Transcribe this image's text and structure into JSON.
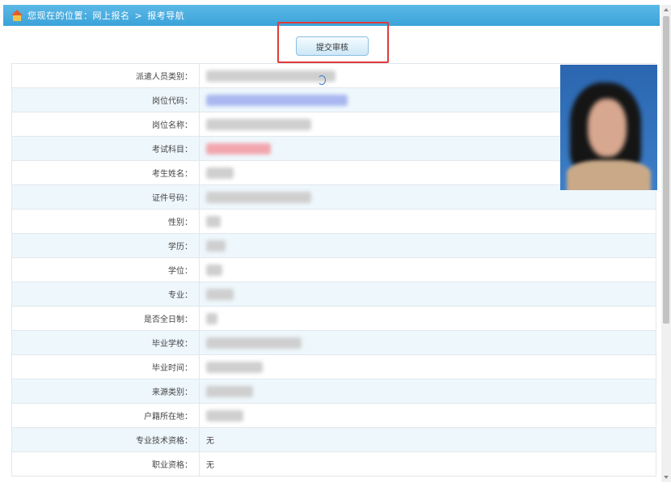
{
  "breadcrumb": {
    "prefix": "您现在的位置：网上报名",
    "separator": ">",
    "current": "报考导航"
  },
  "submit": {
    "label": "提交审核"
  },
  "form": {
    "rows": [
      {
        "label": "派遣人员类别：",
        "value": ""
      },
      {
        "label": "岗位代码：",
        "value": ""
      },
      {
        "label": "岗位名称：",
        "value": ""
      },
      {
        "label": "考试科目：",
        "value": ""
      },
      {
        "label": "考生姓名：",
        "value": ""
      },
      {
        "label": "证件号码：",
        "value": ""
      },
      {
        "label": "性别：",
        "value": ""
      },
      {
        "label": "学历：",
        "value": ""
      },
      {
        "label": "学位：",
        "value": ""
      },
      {
        "label": "专业：",
        "value": ""
      },
      {
        "label": "是否全日制：",
        "value": ""
      },
      {
        "label": "毕业学校：",
        "value": ""
      },
      {
        "label": "毕业时间：",
        "value": ""
      },
      {
        "label": "来源类别：",
        "value": ""
      },
      {
        "label": "户籍所在地：",
        "value": ""
      },
      {
        "label": "专业技术资格：",
        "value": "无"
      },
      {
        "label": "职业资格：",
        "value": "无"
      }
    ]
  },
  "colors": {
    "header_bar": "#3aa3d9",
    "highlight_border": "#e03a3a",
    "row_alt": "#eef7fc"
  }
}
